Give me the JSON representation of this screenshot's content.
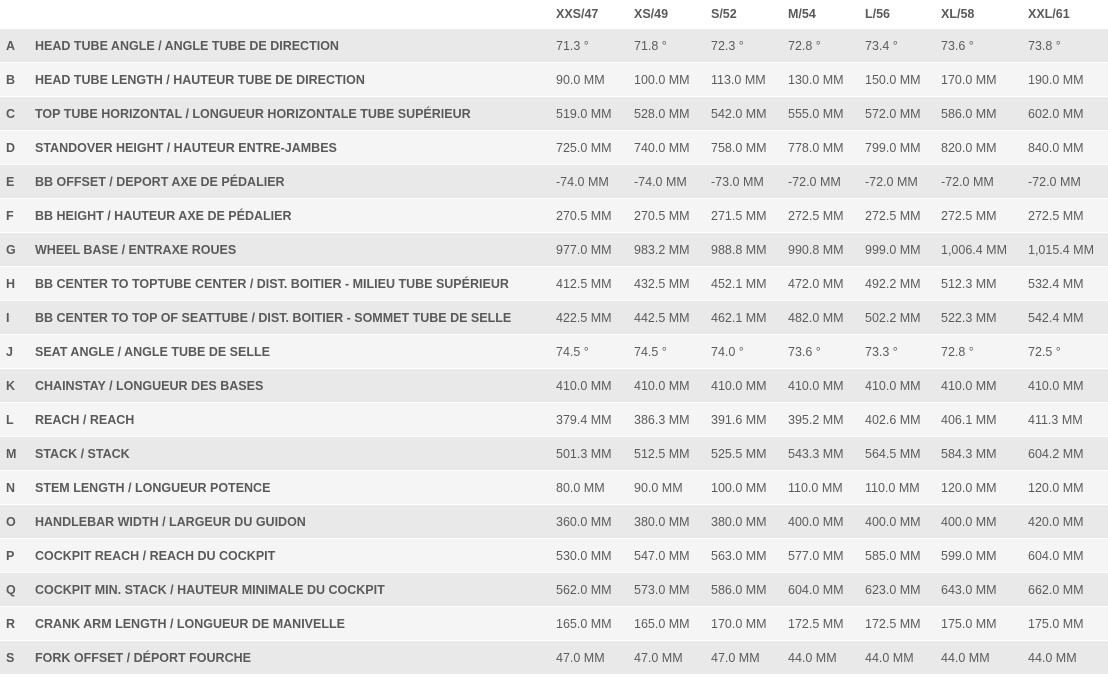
{
  "columns": [
    "XXS/47",
    "XS/49",
    "S/52",
    "M/54",
    "L/56",
    "XL/58",
    "XXL/61"
  ],
  "rows": [
    {
      "letter": "A",
      "label": "HEAD TUBE ANGLE / ANGLE TUBE DE DIRECTION",
      "values": [
        "71.3 °",
        "71.8 °",
        "72.3 °",
        "72.8 °",
        "73.4 °",
        "73.6 °",
        "73.8 °"
      ]
    },
    {
      "letter": "B",
      "label": "HEAD TUBE LENGTH / HAUTEUR TUBE DE DIRECTION",
      "values": [
        "90.0 MM",
        "100.0 MM",
        "113.0 MM",
        "130.0 MM",
        "150.0 MM",
        "170.0 MM",
        "190.0 MM"
      ]
    },
    {
      "letter": "C",
      "label": "TOP TUBE HORIZONTAL / LONGUEUR HORIZONTALE TUBE SUPÉRIEUR",
      "values": [
        "519.0 MM",
        "528.0 MM",
        "542.0 MM",
        "555.0 MM",
        "572.0 MM",
        "586.0 MM",
        "602.0 MM"
      ]
    },
    {
      "letter": "D",
      "label": "STANDOVER HEIGHT / HAUTEUR ENTRE-JAMBES",
      "values": [
        "725.0 MM",
        "740.0 MM",
        "758.0 MM",
        "778.0 MM",
        "799.0 MM",
        "820.0 MM",
        "840.0 MM"
      ]
    },
    {
      "letter": "E",
      "label": "BB OFFSET / DEPORT AXE DE PÉDALIER",
      "values": [
        "-74.0 MM",
        "-74.0 MM",
        "-73.0 MM",
        "-72.0 MM",
        "-72.0 MM",
        "-72.0 MM",
        "-72.0 MM"
      ]
    },
    {
      "letter": "F",
      "label": "BB HEIGHT / HAUTEUR AXE DE PÉDALIER",
      "values": [
        "270.5 MM",
        "270.5 MM",
        "271.5 MM",
        "272.5 MM",
        "272.5 MM",
        "272.5 MM",
        "272.5 MM"
      ]
    },
    {
      "letter": "G",
      "label": "WHEEL BASE / ENTRAXE ROUES",
      "values": [
        "977.0 MM",
        "983.2 MM",
        "988.8 MM",
        "990.8 MM",
        "999.0 MM",
        "1,006.4 MM",
        "1,015.4 MM"
      ]
    },
    {
      "letter": "H",
      "label": "BB CENTER TO TOPTUBE CENTER / DIST. BOITIER - MILIEU TUBE SUPÉRIEUR",
      "values": [
        "412.5 MM",
        "432.5 MM",
        "452.1 MM",
        "472.0 MM",
        "492.2 MM",
        "512.3 MM",
        "532.4 MM"
      ]
    },
    {
      "letter": "I",
      "label": "BB CENTER TO TOP OF SEATTUBE / DIST. BOITIER - SOMMET TUBE DE SELLE",
      "values": [
        "422.5 MM",
        "442.5 MM",
        "462.1 MM",
        "482.0 MM",
        "502.2 MM",
        "522.3 MM",
        "542.4 MM"
      ]
    },
    {
      "letter": "J",
      "label": "SEAT ANGLE / ANGLE TUBE DE SELLE",
      "values": [
        "74.5 °",
        "74.5 °",
        "74.0 °",
        "73.6 °",
        "73.3 °",
        "72.8 °",
        "72.5 °"
      ]
    },
    {
      "letter": "K",
      "label": "CHAINSTAY / LONGUEUR DES BASES",
      "values": [
        "410.0 MM",
        "410.0 MM",
        "410.0 MM",
        "410.0 MM",
        "410.0 MM",
        "410.0 MM",
        "410.0 MM"
      ]
    },
    {
      "letter": "L",
      "label": "REACH / REACH",
      "values": [
        "379.4 MM",
        "386.3 MM",
        "391.6 MM",
        "395.2 MM",
        "402.6 MM",
        "406.1 MM",
        "411.3 MM"
      ]
    },
    {
      "letter": "M",
      "label": "STACK / STACK",
      "values": [
        "501.3 MM",
        "512.5 MM",
        "525.5 MM",
        "543.3 MM",
        "564.5 MM",
        "584.3 MM",
        "604.2 MM"
      ]
    },
    {
      "letter": "N",
      "label": "STEM LENGTH / LONGUEUR POTENCE",
      "values": [
        "80.0 MM",
        "90.0 MM",
        "100.0 MM",
        "110.0 MM",
        "110.0 MM",
        "120.0 MM",
        "120.0 MM"
      ]
    },
    {
      "letter": "O",
      "label": "HANDLEBAR WIDTH / LARGEUR DU GUIDON",
      "values": [
        "360.0 MM",
        "380.0 MM",
        "380.0 MM",
        "400.0 MM",
        "400.0 MM",
        "400.0 MM",
        "420.0 MM"
      ]
    },
    {
      "letter": "P",
      "label": "COCKPIT REACH / REACH DU COCKPIT",
      "values": [
        "530.0 MM",
        "547.0 MM",
        "563.0 MM",
        "577.0 MM",
        "585.0 MM",
        "599.0 MM",
        "604.0 MM"
      ]
    },
    {
      "letter": "Q",
      "label": "COCKPIT MIN. STACK / HAUTEUR MINIMALE DU COCKPIT",
      "values": [
        "562.0 MM",
        "573.0 MM",
        "586.0 MM",
        "604.0 MM",
        "623.0 MM",
        "643.0 MM",
        "662.0 MM"
      ]
    },
    {
      "letter": "R",
      "label": "CRANK ARM LENGTH / LONGUEUR DE MANIVELLE",
      "values": [
        "165.0 MM",
        "165.0 MM",
        "170.0 MM",
        "172.5 MM",
        "172.5 MM",
        "175.0 MM",
        "175.0 MM"
      ]
    },
    {
      "letter": "S",
      "label": "FORK OFFSET / DÉPORT FOURCHE",
      "values": [
        "47.0 MM",
        "47.0 MM",
        "47.0 MM",
        "44.0 MM",
        "44.0 MM",
        "44.0 MM",
        "44.0 MM"
      ]
    }
  ]
}
